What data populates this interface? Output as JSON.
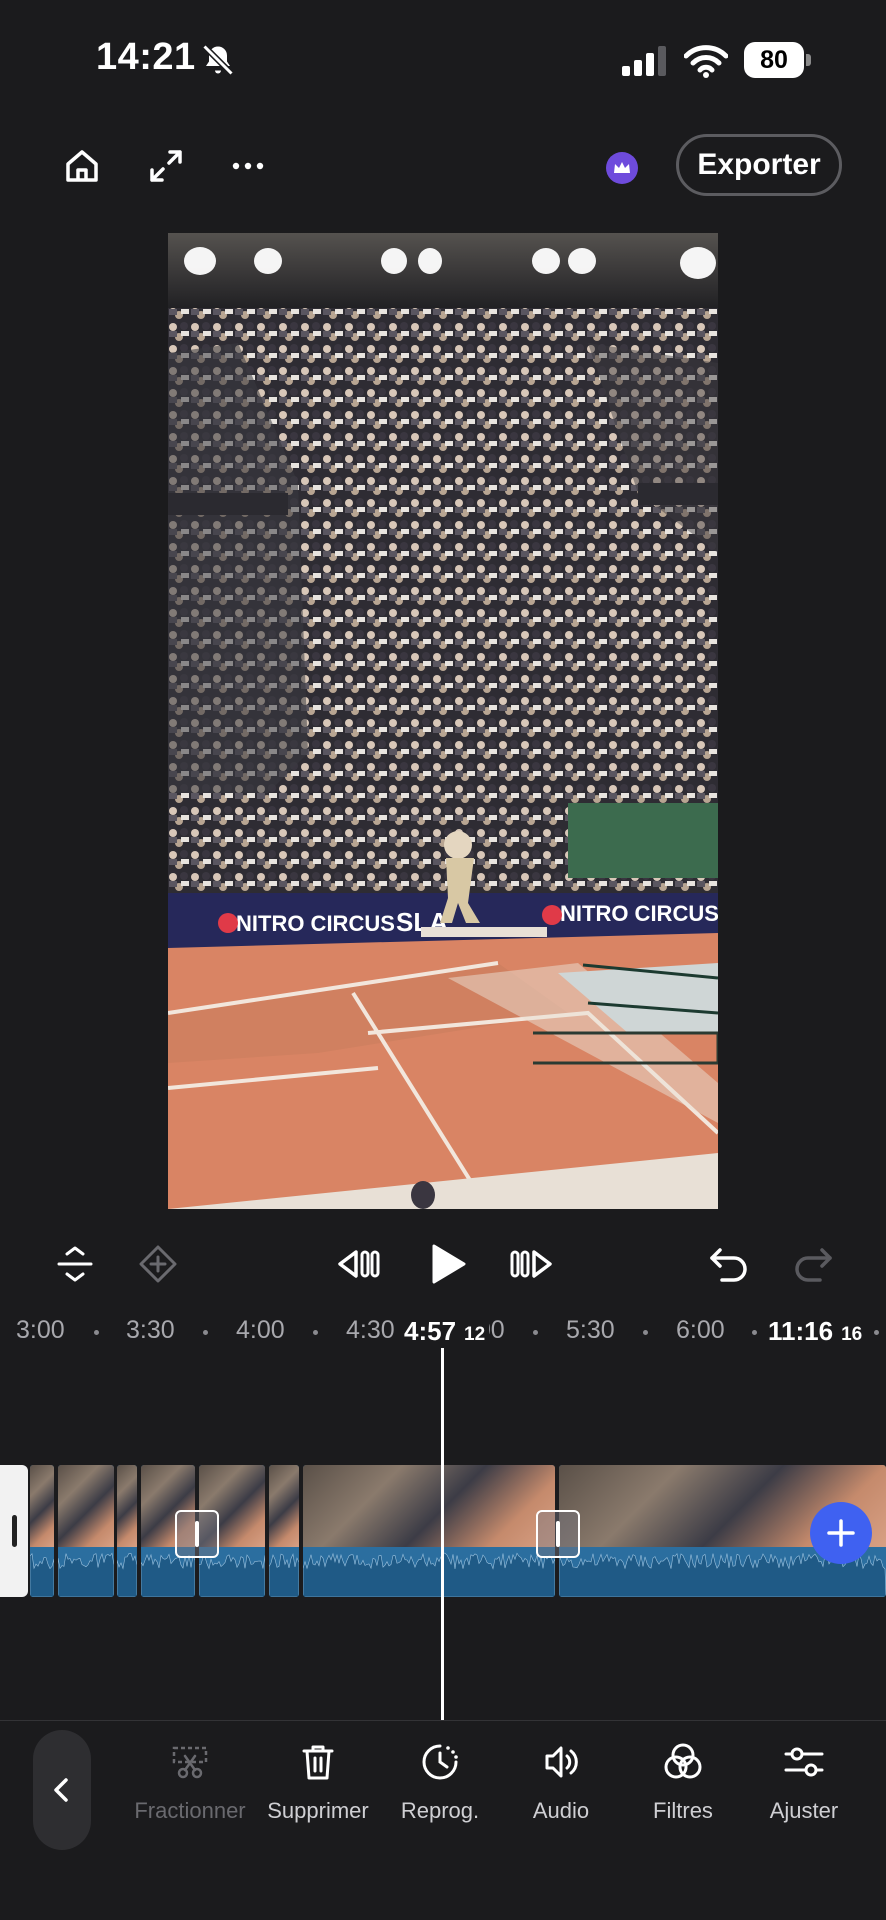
{
  "status_bar": {
    "time": "14:21",
    "battery": "80"
  },
  "top_bar": {
    "export_label": "Exporter"
  },
  "ruler": {
    "ticks": [
      "3:00",
      "3:30",
      "4:00",
      "4:30",
      "5:00",
      "5:30",
      "6:00"
    ],
    "playhead_time": "4:57",
    "playhead_frame": "12",
    "total_time": "11:16",
    "total_frame": "16"
  },
  "toolbar": {
    "tools": [
      {
        "label": "Fractionner",
        "icon": "split-icon",
        "enabled": false
      },
      {
        "label": "Supprimer",
        "icon": "trash-icon",
        "enabled": true
      },
      {
        "label": "Reprog.",
        "icon": "clock-icon",
        "enabled": true
      },
      {
        "label": "Audio",
        "icon": "speaker-icon",
        "enabled": true
      },
      {
        "label": "Filtres",
        "icon": "filters-icon",
        "enabled": true
      },
      {
        "label": "Ajuster",
        "icon": "sliders-icon",
        "enabled": true
      }
    ]
  },
  "colors": {
    "background": "#1b1b1d",
    "accent": "#3f61f1",
    "premium": "#6e4bdc",
    "audio_track": "#2b6e9f"
  }
}
